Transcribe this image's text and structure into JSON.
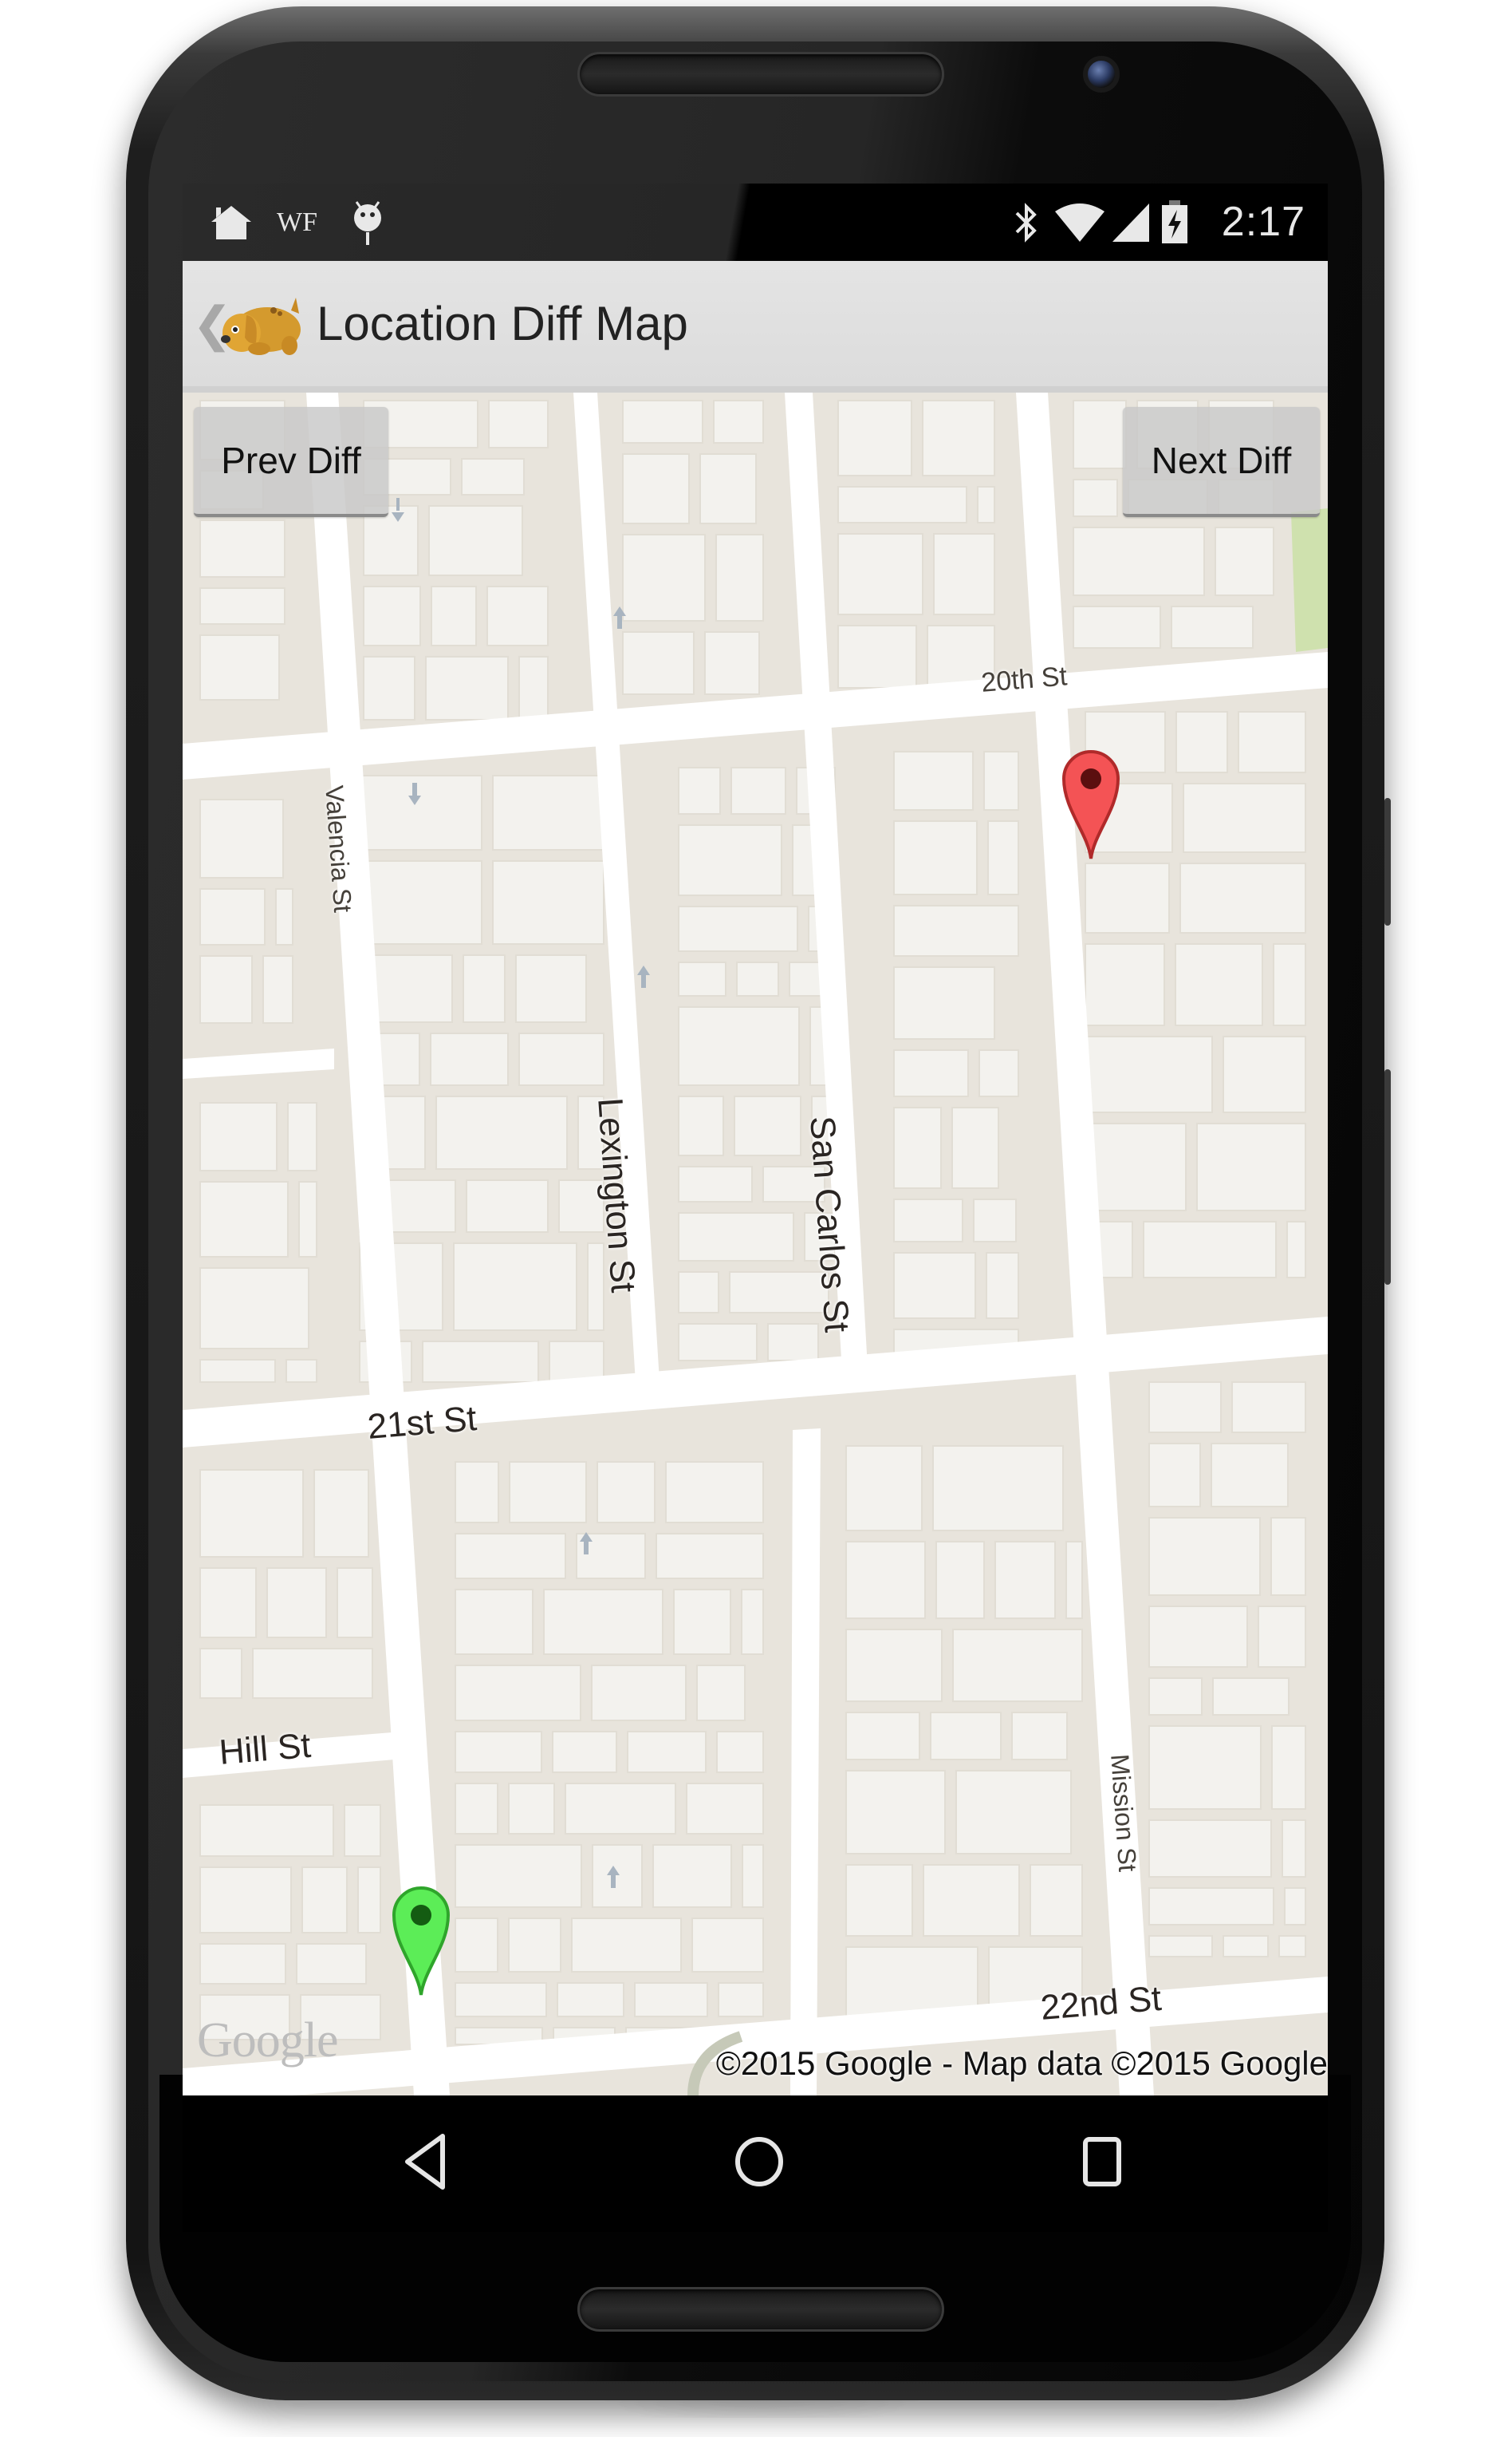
{
  "status_bar": {
    "left_icons": [
      "home-icon",
      "wf-text",
      "android-debug-icon"
    ],
    "wf_label": "WF",
    "right_icons": [
      "bluetooth-icon",
      "wifi-icon",
      "cell-signal-icon",
      "battery-charging-icon"
    ],
    "time": "2:17"
  },
  "toolbar": {
    "back_glyph": "❮",
    "title": "Location Diff Map",
    "app_icon": "dog-icon"
  },
  "map": {
    "prev_button": "Prev Diff",
    "next_button": "Next Diff",
    "street_labels": {
      "s20th": "20th St",
      "s21st": "21st St",
      "s22nd": "22nd St",
      "hill": "Hill St",
      "valencia": "Valencia St",
      "lexington": "Lexington St",
      "san_carlos": "San Carlos St",
      "mission": "Mission St"
    },
    "markers": [
      {
        "name": "red-marker",
        "color": "#f0474a",
        "dot": "#5b0f0f"
      },
      {
        "name": "green-marker",
        "color": "#4ee84a",
        "dot": "#145c12"
      }
    ],
    "google_logo": "Google",
    "attribution": "©2015 Google - Map data ©2015 Google",
    "colors": {
      "block": "#e8e4dc",
      "building": "#f3f2ee",
      "road": "#ffffff",
      "park": "#cfe1ae"
    }
  },
  "nav_bar": {
    "back": "back-icon",
    "home": "home-circle-icon",
    "recents": "recents-icon"
  }
}
